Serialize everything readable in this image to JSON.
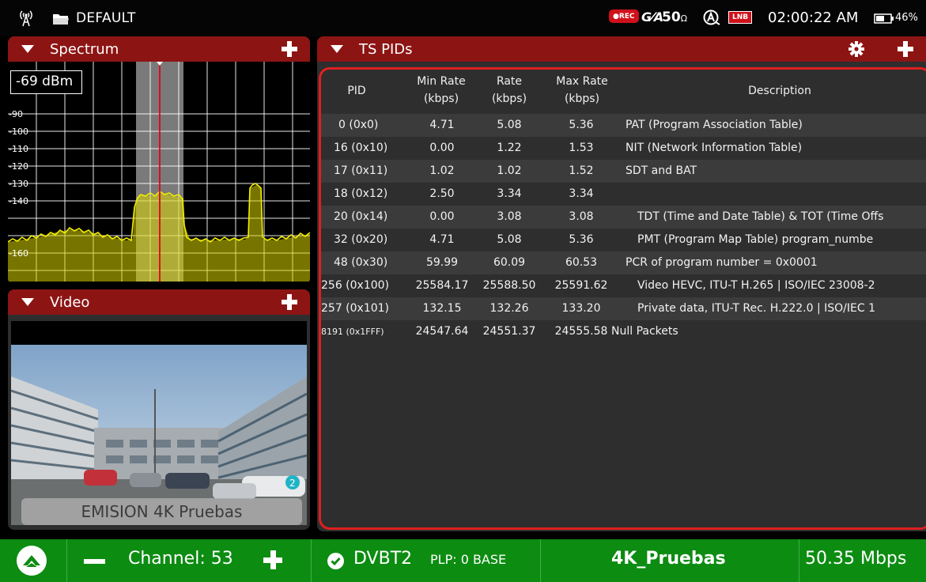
{
  "status_bar": {
    "profile": "DEFAULT",
    "rec_label": "●REC",
    "impedance": "50",
    "impedance_unit": "Ω",
    "lnb_label": "LNB",
    "time": "02:00:22 AM",
    "battery": "46%"
  },
  "spectrum": {
    "title": "Spectrum",
    "marker_level": "-69 dBm",
    "y_ticks": [
      "-90",
      "-100",
      "-110",
      "-120",
      "-130",
      "-140",
      "-160"
    ]
  },
  "video": {
    "title": "Video",
    "service_overlay": "EMISION 4K Pruebas",
    "badge": "2"
  },
  "ts_pids": {
    "title": "TS PIDs",
    "columns": {
      "pid": "PID",
      "min_rate": "Min Rate\n(kbps)",
      "rate": "Rate\n(kbps)",
      "max_rate": "Max Rate\n(kbps)",
      "description": "Description"
    },
    "rows": [
      {
        "pid": "0 (0x0)",
        "min": "4.71",
        "rate": "5.08",
        "max": "5.36",
        "desc": "PAT (Program Association Table)"
      },
      {
        "pid": "16 (0x10)",
        "min": "0.00",
        "rate": "1.22",
        "max": "1.53",
        "desc": "NIT (Network Information Table)"
      },
      {
        "pid": "17 (0x11)",
        "min": "1.02",
        "rate": "1.02",
        "max": "1.52",
        "desc": "SDT and BAT"
      },
      {
        "pid": "18 (0x12)",
        "min": "2.50",
        "rate": "3.34",
        "max": "3.34",
        "desc": ""
      },
      {
        "pid": "20 (0x14)",
        "min": "0.00",
        "rate": "3.08",
        "max": "3.08",
        "desc": "TDT (Time and Date Table) & TOT (Time Offs"
      },
      {
        "pid": "32 (0x20)",
        "min": "4.71",
        "rate": "5.08",
        "max": "5.36",
        "desc": "PMT (Program Map Table) program_numbe"
      },
      {
        "pid": "48 (0x30)",
        "min": "59.99",
        "rate": "60.09",
        "max": "60.53",
        "desc": "PCR of program number = 0x0001"
      },
      {
        "pid": "256 (0x100)",
        "min": "25584.17",
        "rate": "25588.50",
        "max": "25591.62",
        "desc": "Video HEVC, ITU-T H.265 | ISO/IEC 23008-2"
      },
      {
        "pid": "257 (0x101)",
        "min": "132.15",
        "rate": "132.26",
        "max": "133.20",
        "desc": "Private data, ITU-T Rec. H.222.0 | ISO/IEC 1"
      },
      {
        "pid": "8191 (0x1FFF)",
        "min": "24547.64",
        "rate": "24551.37",
        "max": "24555.58",
        "desc": "Null Packets"
      }
    ]
  },
  "bottom_bar": {
    "channel": "Channel: 53",
    "standard": "DVBT2",
    "plp": "PLP: 0 BASE",
    "service": "4K_Pruebas",
    "bitrate": "50.35 Mbps"
  },
  "colors": {
    "panel_header": "#8c1514",
    "panel_body": "#2e2e2e",
    "highlight_border": "#e01f1f",
    "bottom_bar": "#0d8c12",
    "trace": "#e8e400"
  }
}
